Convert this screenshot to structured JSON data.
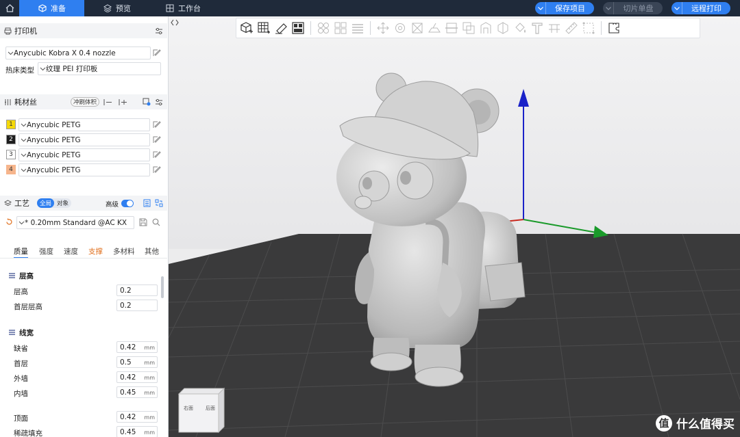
{
  "topbar": {
    "tabs": [
      {
        "label": "准备",
        "icon": "cube-icon",
        "active": true
      },
      {
        "label": "预览",
        "icon": "layers-icon",
        "active": false
      },
      {
        "label": "工作台",
        "icon": "grid-icon",
        "active": false
      }
    ],
    "buttons": {
      "save": "保存项目",
      "slice": "切片单盘",
      "remote": "远程打印"
    },
    "accent": "#2f7ff0"
  },
  "printer": {
    "title": "打印机",
    "model": "Anycubic Kobra X 0.4 nozzle",
    "bed_label": "热床类型",
    "bed_value": "纹理 PEI 打印板"
  },
  "filament": {
    "title": "耗材丝",
    "flush_label": "冲刷体积",
    "items": [
      {
        "num": "1",
        "name": "Anycubic PETG",
        "color": "#f5d90a"
      },
      {
        "num": "2",
        "name": "Anycubic PETG",
        "color": "#1e1e1e"
      },
      {
        "num": "3",
        "name": "Anycubic PETG",
        "color": "#ffffff"
      },
      {
        "num": "4",
        "name": "Anycubic PETG",
        "color": "#f6b58c"
      }
    ]
  },
  "process": {
    "title": "工艺",
    "seg_global": "全局",
    "seg_object": "对象",
    "advanced_label": "高级",
    "preset": "* 0.20mm Standard @AC KX",
    "tabs": [
      "质量",
      "强度",
      "速度",
      "支撑",
      "多材料",
      "其他"
    ],
    "groups": {
      "layer_height": {
        "title": "层高",
        "rows": [
          {
            "label": "层高",
            "value": "0.2",
            "unit": ""
          },
          {
            "label": "首层层高",
            "value": "0.2",
            "unit": ""
          }
        ]
      },
      "line_width": {
        "title": "线宽",
        "rows": [
          {
            "label": "缺省",
            "value": "0.42",
            "unit": "mm"
          },
          {
            "label": "首层",
            "value": "0.5",
            "unit": "mm"
          },
          {
            "label": "外墙",
            "value": "0.42",
            "unit": "mm"
          },
          {
            "label": "内墙",
            "value": "0.45",
            "unit": "mm"
          },
          {
            "label": "顶面",
            "value": "0.42",
            "unit": "mm"
          },
          {
            "label": "稀疏填充",
            "value": "0.45",
            "unit": "mm"
          }
        ]
      }
    }
  },
  "viewport": {
    "navcube": {
      "right": "右面",
      "front": "后面"
    },
    "watermark": "什么值得买",
    "watermark_badge": "值"
  }
}
